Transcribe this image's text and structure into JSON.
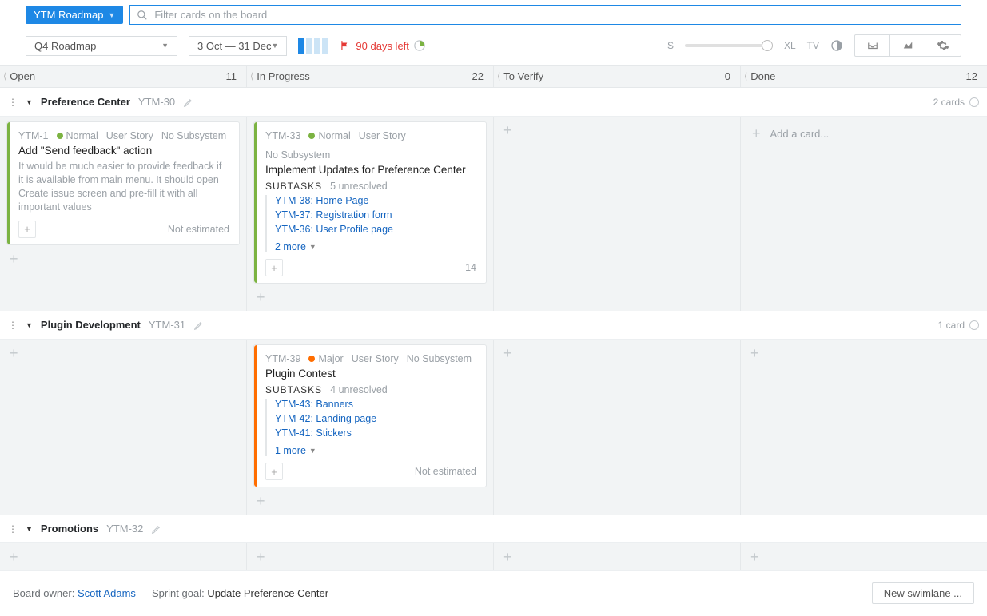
{
  "header": {
    "board_name": "YTM Roadmap",
    "search_placeholder": "Filter cards on the board"
  },
  "toolbar": {
    "sprint_select": "Q4 Roadmap",
    "date_range": "3 Oct — 31 Dec",
    "days_left": "90 days left",
    "size_small": "S",
    "size_large": "XL",
    "tv": "TV"
  },
  "columns": [
    {
      "name": "Open",
      "count": 11
    },
    {
      "name": "In Progress",
      "count": 22
    },
    {
      "name": "To Verify",
      "count": 0
    },
    {
      "name": "Done",
      "count": 12
    }
  ],
  "swimlanes": [
    {
      "name": "Preference Center",
      "key": "YTM-30",
      "summary": "2 cards",
      "cols": [
        {
          "cards": [
            {
              "id": "YTM-1",
              "priority": "Normal",
              "priority_color": "green",
              "type": "User Story",
              "subsystem": "No Subsystem",
              "title": "Add \"Send feedback\" action",
              "desc": "It would be much easier to provide feedback if it is available from main menu. It should open Create issue screen and pre-fill it with all important values",
              "estimated": "Not estimated"
            }
          ]
        },
        {
          "cards": [
            {
              "id": "YTM-33",
              "priority": "Normal",
              "priority_color": "green",
              "type": "User Story",
              "subsystem": "No Subsystem",
              "title": "Implement Updates for Preference Center",
              "subtasks_label": "SUBTASKS",
              "subtasks_unresolved": "5 unresolved",
              "subtasks": [
                "YTM-38: Home Page",
                "YTM-37: Registration form",
                "YTM-36: User Profile page"
              ],
              "more": "2 more",
              "points": "14"
            }
          ]
        },
        {
          "cards": []
        },
        {
          "add_hint": "Add a card...",
          "cards": []
        }
      ]
    },
    {
      "name": "Plugin Development",
      "key": "YTM-31",
      "summary": "1 card",
      "cols": [
        {
          "cards": []
        },
        {
          "cards": [
            {
              "id": "YTM-39",
              "priority": "Major",
              "priority_color": "orange",
              "type": "User Story",
              "subsystem": "No Subsystem",
              "title": "Plugin Contest",
              "subtasks_label": "SUBTASKS",
              "subtasks_unresolved": "4 unresolved",
              "subtasks": [
                "YTM-43: Banners",
                "YTM-42: Landing page",
                "YTM-41: Stickers"
              ],
              "more": "1 more",
              "estimated": "Not estimated"
            }
          ]
        },
        {
          "cards": []
        },
        {
          "cards": []
        }
      ]
    },
    {
      "name": "Promotions",
      "key": "YTM-32",
      "summary": "",
      "cols": [
        {
          "cards": []
        },
        {
          "cards": []
        },
        {
          "cards": []
        },
        {
          "cards": []
        }
      ]
    }
  ],
  "footer": {
    "owner_label": "Board owner:",
    "owner": "Scott Adams",
    "goal_label": "Sprint goal:",
    "goal": "Update Preference Center",
    "new_swimlane": "New swimlane ..."
  }
}
